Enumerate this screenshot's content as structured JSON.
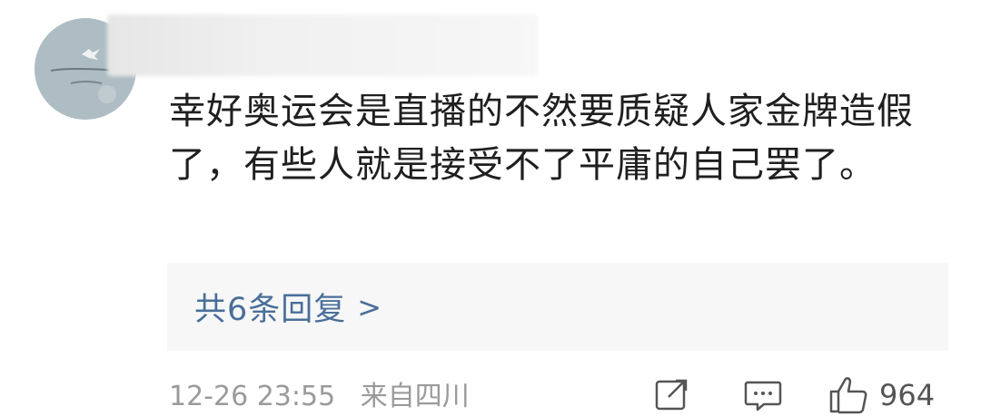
{
  "comment": {
    "avatar_icon": "avatar-image",
    "text": "幸好奥运会是直播的不然要质疑人家金牌造假了，有些人就是接受不了平庸的自己罢了。",
    "replies": {
      "label": "共6条回复",
      "arrow": ">"
    },
    "meta": {
      "timestamp": "12-26 23:55",
      "location": "来自四川"
    },
    "actions": {
      "share_icon": "share-icon",
      "comment_icon": "comment-icon",
      "like_icon": "thumbs-up-icon",
      "like_count": "964"
    }
  }
}
